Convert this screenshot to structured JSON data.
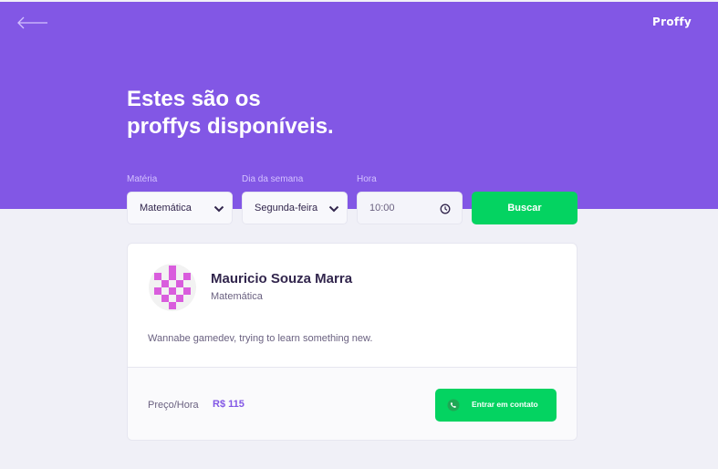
{
  "header": {
    "logo": "Proffy",
    "title": "Estes são os\nproffys disponíveis."
  },
  "filters": {
    "subject": {
      "label": "Matéria",
      "value": "Matemática"
    },
    "weekday": {
      "label": "Dia da semana",
      "value": "Segunda-feira"
    },
    "time": {
      "label": "Hora",
      "value": "10:00"
    },
    "search_label": "Buscar"
  },
  "teacher": {
    "name": "Mauricio Souza Marra",
    "subject": "Matemática",
    "bio": "Wannabe gamedev, trying to learn something new.",
    "price_label": "Preço/Hora",
    "price": "R$ 115",
    "contact_label": "Entrar em contato"
  },
  "colors": {
    "primary": "#8257e5",
    "accent": "#04d361",
    "background": "#f0f0f7",
    "avatar_pattern": "#d95ddd"
  },
  "icons": {
    "back": "arrow-left-icon",
    "select": "chevron-down-icon",
    "time": "clock-icon",
    "contact": "whatsapp-icon"
  }
}
